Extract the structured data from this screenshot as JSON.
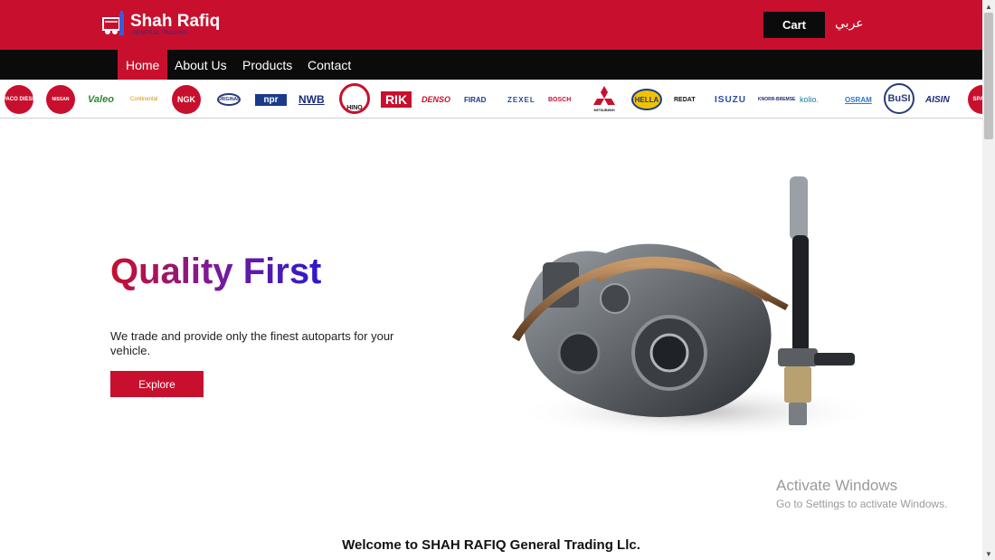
{
  "header": {
    "logo_title": "Shah Rafiq",
    "logo_sub": "GENERAL TRADING",
    "cart_label": "Cart",
    "language_label": "عربي",
    "colors": {
      "brand_red": "#c8102e",
      "dark": "#0b0b0b"
    }
  },
  "nav": {
    "items": [
      {
        "label": "Home",
        "active": true
      },
      {
        "label": "About Us",
        "active": false
      },
      {
        "label": "Products",
        "active": false
      },
      {
        "label": "Contact",
        "active": false
      }
    ]
  },
  "brands": [
    {
      "label": "SPACO DIESEL"
    },
    {
      "label": "NISSAN"
    },
    {
      "label": "Valeo"
    },
    {
      "label": "Continental"
    },
    {
      "label": "NGK"
    },
    {
      "label": "ORIGINAL"
    },
    {
      "label": "npr"
    },
    {
      "label": "NWB"
    },
    {
      "label": "HINO"
    },
    {
      "label": "RIK"
    },
    {
      "label": "DENSO"
    },
    {
      "label": "FIRAD"
    },
    {
      "label": "ZEXEL"
    },
    {
      "label": "BOSCH"
    },
    {
      "label": "MITSUBISHI"
    },
    {
      "label": "HELLA"
    },
    {
      "label": "REDAT"
    },
    {
      "label": "ISUZU"
    },
    {
      "label": "KNORR-BREMSE"
    },
    {
      "label": "kolio."
    },
    {
      "label": "OSRAM"
    },
    {
      "label": "BuSI"
    },
    {
      "label": "AISIN"
    },
    {
      "label": "SPACO"
    }
  ],
  "hero": {
    "title": "Quality First",
    "text": "We trade and provide only the finest autoparts for your vehicle.",
    "explore_label": "Explore",
    "image_icon": "engine-injector-image"
  },
  "watermark": {
    "title": "Activate Windows",
    "subtitle": "Go to Settings to activate Windows."
  },
  "welcome_text": "Welcome to SHAH RAFIQ General Trading Llc."
}
